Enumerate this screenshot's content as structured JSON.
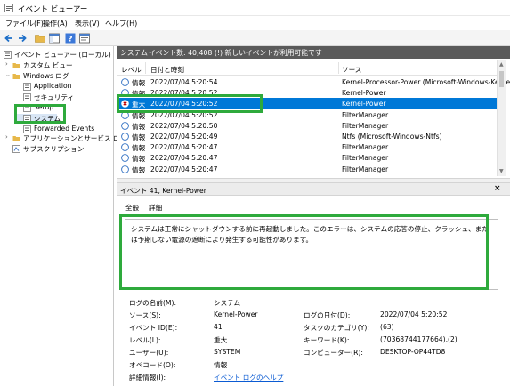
{
  "window": {
    "title": "イベント ビューアー"
  },
  "menu": {
    "file": "ファイル(F)",
    "action": "操作(A)",
    "view": "表示(V)",
    "help": "ヘルプ(H)"
  },
  "tree": {
    "root": "イベント ビューアー (ローカル)",
    "custom_views": "カスタム ビュー",
    "windows_logs": "Windows ログ",
    "application": "Application",
    "security": "セキュリティ",
    "setup": "Setup",
    "system": "システム",
    "forwarded": "Forwarded Events",
    "apps_services": "アプリケーションとサービス ログ",
    "subscriptions": "サブスクリプション"
  },
  "log_header": {
    "name": "システム",
    "count_text": "イベント数: 40,408 (!) 新しいイベントが利用可能です"
  },
  "columns": {
    "level": "レベル",
    "datetime": "日付と時刻",
    "source": "ソース"
  },
  "events": [
    {
      "level": "情報",
      "datetime": "2022/07/04 5:20:54",
      "source": "Kernel-Processor-Power (Microsoft-Windows-Kerne",
      "kind": "info"
    },
    {
      "level": "情報",
      "datetime": "2022/07/04 5:20:52",
      "source": "Kernel-Power",
      "kind": "info"
    },
    {
      "level": "重大",
      "datetime": "2022/07/04 5:20:52",
      "source": "Kernel-Power",
      "kind": "critical"
    },
    {
      "level": "情報",
      "datetime": "2022/07/04 5:20:52",
      "source": "FilterManager",
      "kind": "info"
    },
    {
      "level": "情報",
      "datetime": "2022/07/04 5:20:50",
      "source": "FilterManager",
      "kind": "info"
    },
    {
      "level": "情報",
      "datetime": "2022/07/04 5:20:49",
      "source": "Ntfs (Microsoft-Windows-Ntfs)",
      "kind": "info"
    },
    {
      "level": "情報",
      "datetime": "2022/07/04 5:20:47",
      "source": "FilterManager",
      "kind": "info"
    },
    {
      "level": "情報",
      "datetime": "2022/07/04 5:20:47",
      "source": "FilterManager",
      "kind": "info"
    },
    {
      "level": "情報",
      "datetime": "2022/07/04 5:20:47",
      "source": "FilterManager",
      "kind": "info"
    }
  ],
  "detail": {
    "title": "イベント 41, Kernel-Power",
    "close": "×",
    "tab_general": "全般",
    "tab_details": "詳細",
    "message": "システムは正常にシャットダウンする前に再起動しました。このエラーは、システムの応答の停止、クラッシュ、または予期しない電源の遮断により発生する可能性があります。",
    "log_name_label": "ログの名前(M):",
    "log_name": "システム",
    "source_label": "ソース(S):",
    "source": "Kernel-Power",
    "logged_label": "ログの日付(D):",
    "logged": "2022/07/04 5:20:52",
    "event_id_label": "イベント ID(E):",
    "event_id": "41",
    "task_label": "タスクのカテゴリ(Y):",
    "task": "(63)",
    "level_label": "レベル(L):",
    "level": "重大",
    "keywords_label": "キーワード(K):",
    "keywords": "(70368744177664),(2)",
    "user_label": "ユーザー(U):",
    "user": "SYSTEM",
    "computer_label": "コンピューター(R):",
    "computer": "DESKTOP-OP44TD8",
    "opcode_label": "オペコード(O):",
    "opcode": "情報",
    "more_label": "詳細情報(I):",
    "more_link": "イベント ログのヘルプ"
  },
  "colors": {
    "highlight": "#2eaa3c",
    "selection": "#0078d7",
    "header_bar": "#5a5a5a"
  }
}
